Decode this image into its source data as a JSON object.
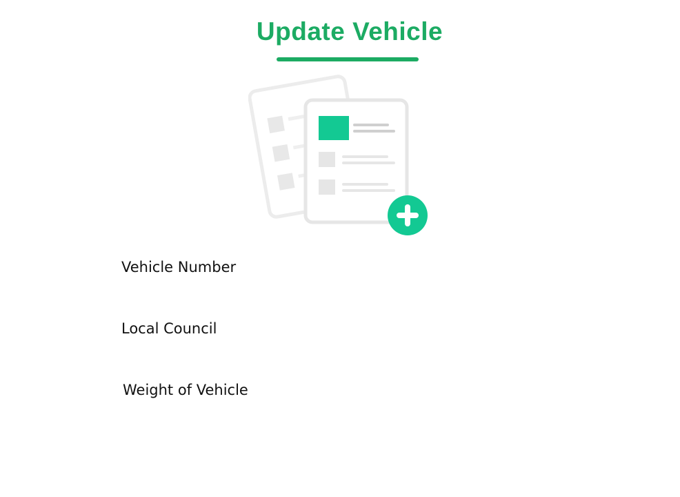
{
  "page": {
    "title": "Update Vehicle",
    "accent_color": "#1cab63",
    "illustration_accent_color": "#13c993",
    "illustration_icon": "add-document-icon"
  },
  "form": {
    "fields": [
      {
        "label": "Vehicle Number"
      },
      {
        "label": "Local Council"
      },
      {
        "label": "Weight of Vehicle"
      }
    ]
  }
}
